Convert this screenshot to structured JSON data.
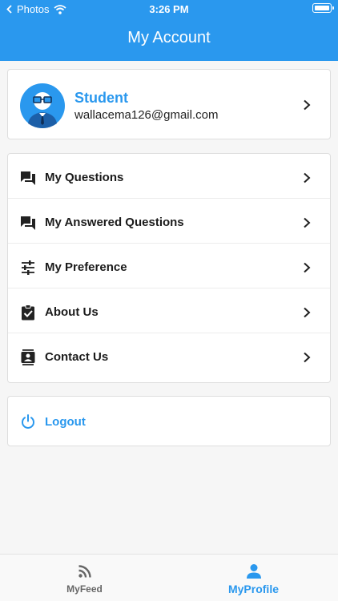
{
  "status_bar": {
    "back_app": "Photos",
    "time": "3:26 PM"
  },
  "header": {
    "title": "My Account"
  },
  "profile": {
    "name": "Student",
    "email": "wallacema126@gmail.com"
  },
  "menu": {
    "items": [
      {
        "label": "My Questions",
        "icon": "chat-bubbles-icon"
      },
      {
        "label": "My Answered Questions",
        "icon": "chat-bubbles-icon"
      },
      {
        "label": "My Preference",
        "icon": "tune-sliders-icon"
      },
      {
        "label": "About Us",
        "icon": "clipboard-check-icon"
      },
      {
        "label": "Contact Us",
        "icon": "contact-card-icon"
      }
    ]
  },
  "logout": {
    "label": "Logout"
  },
  "bottom_nav": {
    "items": [
      {
        "label": "MyFeed",
        "icon": "rss-feed-icon",
        "active": false
      },
      {
        "label": "MyProfile",
        "icon": "person-icon",
        "active": true
      }
    ]
  },
  "colors": {
    "primary": "#2a98ee",
    "text": "#1b1b1b",
    "background": "#f6f6f6"
  }
}
